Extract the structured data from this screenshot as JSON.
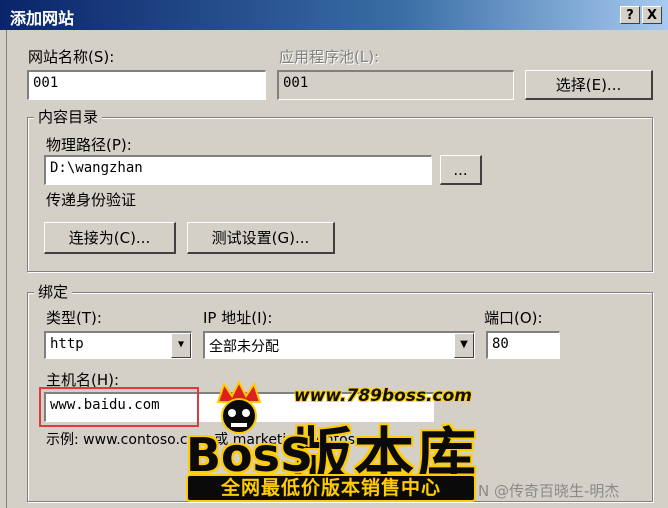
{
  "window": {
    "title": "添加网站",
    "help_button": "?",
    "close_button": "X"
  },
  "site_name": {
    "label": "网站名称(S):",
    "value": "001"
  },
  "app_pool": {
    "label": "应用程序池(L):",
    "value": "001",
    "select_button": "选择(E)..."
  },
  "content_dir": {
    "group_title": "内容目录",
    "physical_path_label": "物理路径(P):",
    "physical_path_value": "D:\\wangzhan",
    "browse_button": "...",
    "passthrough_label": "传递身份验证",
    "connect_as_button": "连接为(C)...",
    "test_settings_button": "测试设置(G)..."
  },
  "binding": {
    "group_title": "绑定",
    "type_label": "类型(T):",
    "type_value": "http",
    "ip_label": "IP 地址(I):",
    "ip_value": "全部未分配",
    "port_label": "端口(O):",
    "port_value": "80",
    "host_label": "主机名(H):",
    "host_value": "www.baidu.com",
    "example_text": "示例: www.contoso.com 或 marketing.contoso.com"
  },
  "watermark": {
    "url": "www.789boss.com",
    "brand_latin": "BosS",
    "brand_cn": "版本库",
    "slogan": "全网最低价版本销售中心",
    "credit": "N @传奇百晓生-明杰"
  },
  "colors": {
    "titlebar_start": "#0a246a",
    "dialog_bg": "#d4d0c8",
    "highlight_box": "#e0393e",
    "watermark_yellow": "#ffcc00"
  }
}
